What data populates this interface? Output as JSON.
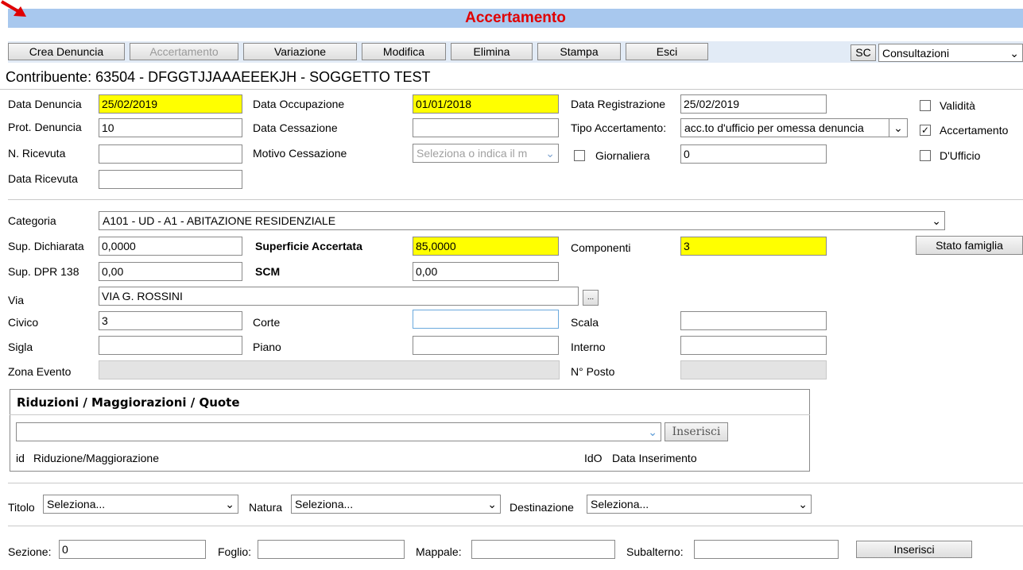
{
  "header": {
    "title": "Accertamento",
    "accent": "#a8c8ee",
    "title_color": "#e00000"
  },
  "toolbar": {
    "buttons": [
      "Crea Denuncia",
      "Accertamento",
      "Variazione",
      "Modifica",
      "Elimina",
      "Stampa",
      "Esci"
    ],
    "sc_label": "SC",
    "consult_value": "Consultazioni"
  },
  "contribuente": "Contribuente: 63504 - DFGGTJJAAAEEEKJH - SOGGETTO TEST",
  "denuncia": {
    "data_denuncia_label": "Data Denuncia",
    "data_denuncia": "25/02/2019",
    "prot_label": "Prot. Denuncia",
    "prot": "10",
    "ricevuta_label": "N. Ricevuta",
    "ricevuta": "",
    "data_ricevuta_label": "Data Ricevuta",
    "data_ricevuta": "",
    "occupazione_label": "Data Occupazione",
    "occupazione": "01/01/2018",
    "cessazione_label": "Data Cessazione",
    "cessazione": "",
    "motivo_label": "Motivo Cessazione",
    "motivo_placeholder": "Seleziona o indica il m",
    "registrazione_label": "Data Registrazione",
    "registrazione": "25/02/2019",
    "tipo_label": "Tipo Accertamento:",
    "tipo": "acc.to d'ufficio per omessa denuncia",
    "giornaliera_label": "Giornaliera",
    "giornaliera_value": "0",
    "validita_label": "Validità",
    "accertamento_label": "Accertamento",
    "ufficio_label": "D'Ufficio"
  },
  "immobile": {
    "categoria_label": "Categoria",
    "categoria": "A101 - UD - A1 - ABITAZIONE RESIDENZIALE",
    "sup_dich_label": "Sup. Dichiarata",
    "sup_dich": "0,0000",
    "sup_acc_label": "Superficie Accertata",
    "sup_acc": "85,0000",
    "componenti_label": "Componenti",
    "componenti": "3",
    "stato_famiglia": "Stato famiglia",
    "dpr_label": "Sup. DPR 138",
    "dpr": "0,00",
    "scm_label": "SCM",
    "scm": "0,00",
    "via_label": "Via",
    "via": "VIA G. ROSSINI",
    "via_btn": "...",
    "civico_label": "Civico",
    "civico": "3",
    "corte_label": "Corte",
    "corte": "",
    "scala_label": "Scala",
    "scala": "",
    "sigla_label": "Sigla",
    "sigla": "",
    "piano_label": "Piano",
    "piano": "",
    "interno_label": "Interno",
    "interno": "",
    "zona_label": "Zona Evento",
    "posto_label": "N° Posto"
  },
  "riduzioni": {
    "title": "Riduzioni / Maggiorazioni / Quote",
    "inserisci": "Inserisci",
    "col_id": "id",
    "col_rid": "Riduzione/Maggiorazione",
    "col_ido": "IdO",
    "col_data": "Data Inserimento"
  },
  "filtri": {
    "titolo_label": "Titolo",
    "titolo": "Seleziona...",
    "natura_label": "Natura",
    "natura": "Seleziona...",
    "destinazione_label": "Destinazione",
    "destinazione": "Seleziona..."
  },
  "catasto": {
    "sezione_label": "Sezione:",
    "sezione": "0",
    "foglio_label": "Foglio:",
    "foglio": "",
    "mappale_label": "Mappale:",
    "mappale": "",
    "subalterno_label": "Subalterno:",
    "subalterno": "",
    "inserisci": "Inserisci"
  }
}
